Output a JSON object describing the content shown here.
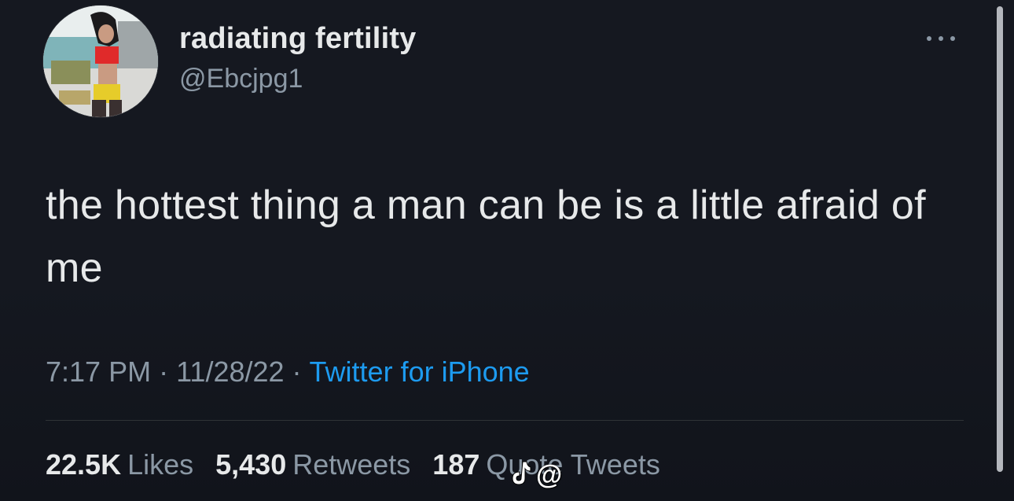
{
  "author": {
    "display_name": "radiating fertility",
    "handle": "@Ebcjpg1"
  },
  "tweet": {
    "text": "the hottest thing a man can be is a little afraid of me",
    "time": "7:17 PM",
    "separator": "·",
    "date": "11/28/22",
    "source": "Twitter for iPhone"
  },
  "stats": {
    "likes_count": "22.5K",
    "likes_label": "Likes",
    "retweets_count": "5,430",
    "retweets_label": "Retweets",
    "quotes_count": "187",
    "quotes_label": "Quote Tweets"
  },
  "watermark": {
    "text": "@"
  },
  "icons": {
    "more": "more-dots-icon",
    "watermark_logo": "tiktok-logo-icon"
  },
  "colors": {
    "background": "#151820",
    "text": "#e7e9ea",
    "muted": "#8b98a5",
    "link": "#1d9bf0"
  }
}
